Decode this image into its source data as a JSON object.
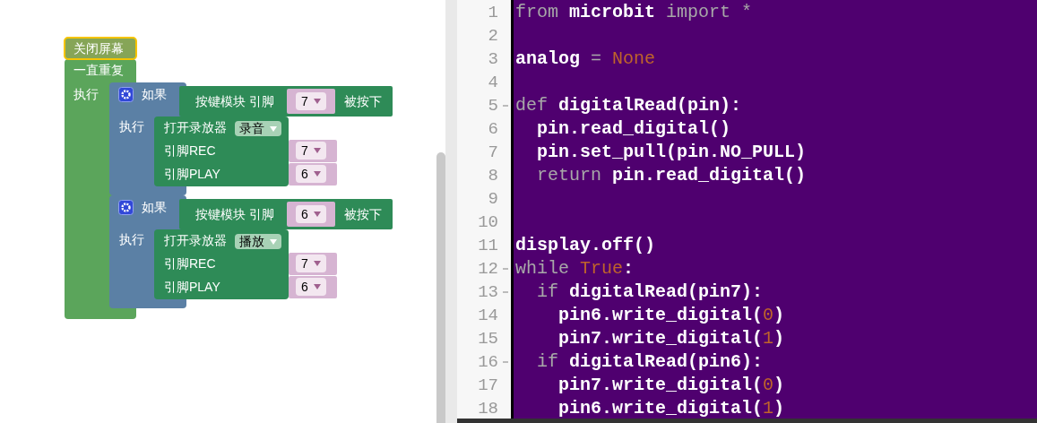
{
  "workspace": {
    "screen_block": {
      "label": "关闭屏幕",
      "selected": true
    },
    "loop_block": {
      "label": "一直重复",
      "do_label": "执行",
      "if_blocks": [
        {
          "if_label": "如果",
          "do_label": "执行",
          "condition": {
            "label": "按键模块 引脚",
            "pin": "7",
            "suffix": "被按下"
          },
          "player": {
            "label": "打开录放器",
            "mode": "录音",
            "rec_label": "引脚REC",
            "rec_pin": "7",
            "play_label": "引脚PLAY",
            "play_pin": "6"
          }
        },
        {
          "if_label": "如果",
          "do_label": "执行",
          "condition": {
            "label": "按键模块 引脚",
            "pin": "6",
            "suffix": "被按下"
          },
          "player": {
            "label": "打开录放器",
            "mode": "播放",
            "rec_label": "引脚REC",
            "rec_pin": "7",
            "play_label": "引脚PLAY",
            "play_pin": "6"
          }
        }
      ]
    }
  },
  "editor": {
    "lines": [
      {
        "number": "1",
        "foldable": false,
        "tokens": [
          {
            "kind": "keyword",
            "text": "from"
          },
          {
            "kind": "name",
            "text": " microbit "
          },
          {
            "kind": "keyword",
            "text": "import *"
          }
        ]
      },
      {
        "number": "2",
        "foldable": false
      },
      {
        "number": "3",
        "foldable": false,
        "tokens": [
          {
            "kind": "name",
            "text": "analog"
          },
          {
            "kind": "keyword",
            "text": " = "
          },
          {
            "kind": "constant",
            "text": "None"
          }
        ]
      },
      {
        "number": "4",
        "foldable": false
      },
      {
        "number": "5",
        "foldable": true,
        "tokens": [
          {
            "kind": "keyword",
            "text": "def"
          },
          {
            "kind": "name",
            "text": " digitalRead(pin):"
          }
        ]
      },
      {
        "number": "6",
        "foldable": false,
        "tokens": [
          {
            "kind": "name",
            "text": "  pin.read_digital()"
          }
        ]
      },
      {
        "number": "7",
        "foldable": false,
        "tokens": [
          {
            "kind": "name",
            "text": "  pin.set_pull(pin.NO_PULL)"
          }
        ]
      },
      {
        "number": "8",
        "foldable": false,
        "tokens": [
          {
            "kind": "keyword",
            "text": "  return"
          },
          {
            "kind": "name",
            "text": " pin.read_digital()"
          }
        ]
      },
      {
        "number": "9",
        "foldable": false
      },
      {
        "number": "10",
        "foldable": false
      },
      {
        "number": "11",
        "foldable": false,
        "tokens": [
          {
            "kind": "name",
            "text": "display.off()"
          }
        ]
      },
      {
        "number": "12",
        "foldable": true,
        "tokens": [
          {
            "kind": "keyword",
            "text": "while"
          },
          {
            "kind": "constant",
            "text": " True"
          },
          {
            "kind": "name",
            "text": ":"
          }
        ]
      },
      {
        "number": "13",
        "foldable": true,
        "tokens": [
          {
            "kind": "keyword",
            "text": "  if"
          },
          {
            "kind": "name",
            "text": " digitalRead(pin7):"
          }
        ]
      },
      {
        "number": "14",
        "foldable": false,
        "tokens": [
          {
            "kind": "name",
            "text": "    pin6.write_digital("
          },
          {
            "kind": "constant",
            "text": "0"
          },
          {
            "kind": "name",
            "text": ")"
          }
        ]
      },
      {
        "number": "15",
        "foldable": false,
        "tokens": [
          {
            "kind": "name",
            "text": "    pin7.write_digital("
          },
          {
            "kind": "constant",
            "text": "1"
          },
          {
            "kind": "name",
            "text": ")"
          }
        ]
      },
      {
        "number": "16",
        "foldable": true,
        "tokens": [
          {
            "kind": "keyword",
            "text": "  if"
          },
          {
            "kind": "name",
            "text": " digitalRead(pin6):"
          }
        ]
      },
      {
        "number": "17",
        "foldable": false,
        "tokens": [
          {
            "kind": "name",
            "text": "    pin7.write_digital("
          },
          {
            "kind": "constant",
            "text": "0"
          },
          {
            "kind": "name",
            "text": ")"
          }
        ]
      },
      {
        "number": "18",
        "foldable": false,
        "tokens": [
          {
            "kind": "name",
            "text": "    pin6.write_digital("
          },
          {
            "kind": "constant",
            "text": "1"
          },
          {
            "kind": "name",
            "text": ")"
          }
        ]
      }
    ]
  }
}
